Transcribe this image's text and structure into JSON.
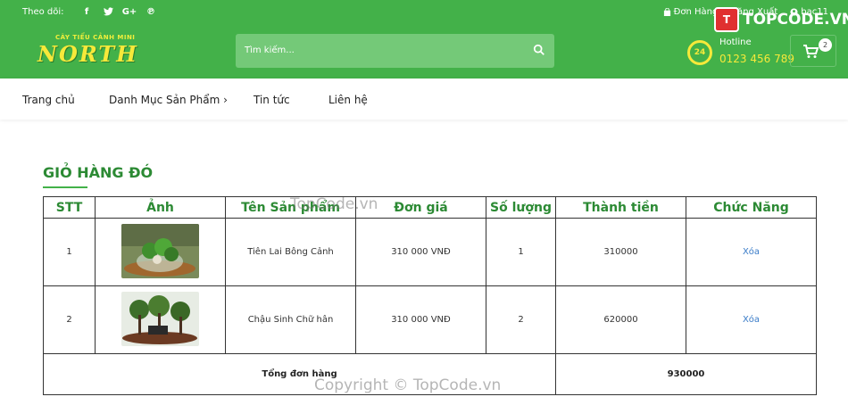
{
  "topbar": {
    "follow_label": "Theo dõi:",
    "socials": [
      "facebook-icon",
      "twitter-icon",
      "google-plus-icon",
      "pinterest-icon"
    ],
    "orders_label": "Đơn Hàng",
    "logout_label": "Đăng Xuất",
    "user_label": "bac11"
  },
  "header": {
    "logo_small": "CÂY TIỂU CẢNH MINI",
    "logo_big": "NORTH",
    "search_placeholder": "Tìm kiếm...",
    "hotline_badge": "24",
    "hotline_label": "Hotline",
    "hotline_number": "0123 456 789",
    "cart_count": "2"
  },
  "watermark_logo": "TOPCODE.VN",
  "nav": {
    "items": [
      "Trang chủ",
      "Danh Mục Sản Phẩm ›",
      "Tin tức",
      "Liên hệ"
    ]
  },
  "cart": {
    "title": "GIỎ HÀNG ĐÓ",
    "headers": [
      "STT",
      "Ảnh",
      "Tên Sản phẩm",
      "Đơn giá",
      "Số lượng",
      "Thành tiền",
      "Chức Năng"
    ],
    "rows": [
      {
        "stt": "1",
        "name": "Tiên Lai Bông Cảnh",
        "price": "310 000 VNĐ",
        "qty": "1",
        "total": "310000",
        "action": "Xóa"
      },
      {
        "stt": "2",
        "name": "Chậu Sinh Chữ hân",
        "price": "310 000 VNĐ",
        "qty": "2",
        "total": "620000",
        "action": "Xóa"
      }
    ],
    "total_label": "Tổng đơn hàng",
    "total_value": "930000"
  },
  "watermarks": {
    "mid": "TopCode.vn",
    "bottom": "Copyright © TopCode.vn"
  },
  "colors": {
    "brand_green": "#43b149",
    "heading_green": "#2c8a34",
    "accent_yellow": "#f6e93a",
    "link_blue": "#3a7cc8"
  }
}
